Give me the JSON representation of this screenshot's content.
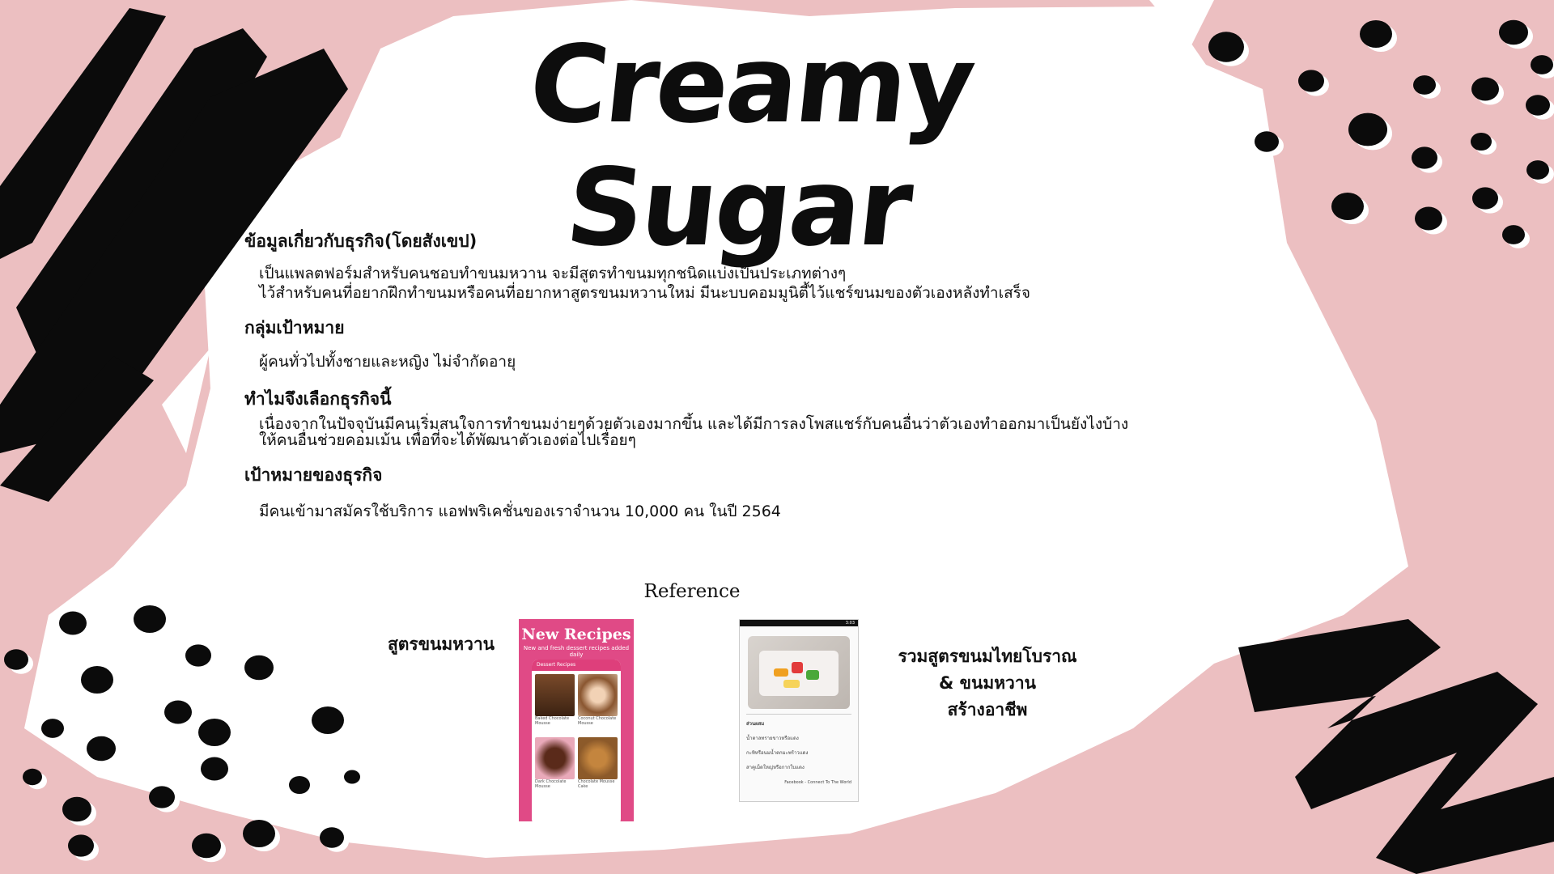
{
  "title": "Creamy Sugar",
  "sections": [
    {
      "heading": "ข้อมูลเกี่ยวกับธุรกิจ(โดยสังเขป)",
      "lines": [
        "เป็นแพลตฟอร์มสำหรับคนชอบทำขนมหวาน จะมีสูตรทำขนมทุกชนิดแบ่งเป็นประเภทต่างๆ",
        "ไว้สำหรับคนที่อยากฝึกทำขนมหรือคนที่อยากหาสูตรขนมหวานใหม่ มีนะบบคอมมูนิตี้ไว้แชร์ขนมของตัวเองหลังทำเสร็จ"
      ]
    },
    {
      "heading": "กลุ่มเป้าหมาย",
      "lines": [
        "ผู้คนทั่วไปทั้งชายและหญิง ไม่จำกัดอายุ"
      ]
    },
    {
      "heading": "ทำไมจึงเลือกธุรกิจนี้",
      "lines": [
        "เนื่องจากในปัจจุบันมีคนเริ่มสนใจการทำขนมง่ายๆด้วยตัวเองมากขึ้น และได้มีการลงโพสแชร์กับคนอื่นว่าตัวเองทำออกมาเป็นยังไงบ้าง",
        "ให้คนอื่นช่วยคอมเม้น เพื่อที่จะได้พัฒนาตัวเองต่อไปเรื่อยๆ"
      ]
    },
    {
      "heading": "เป้าหมายของธุรกิจ",
      "lines": [
        "มีคนเข้ามาสมัครใช้บริการ แอฟพริเคชั่นของเราจำนวน 10,000 คน ในปี 2564"
      ]
    }
  ],
  "reference": {
    "title": "Reference",
    "left_label": "สูตรขนมหวาน",
    "right_label_lines": [
      "รวมสูตรขนมไทยโบราณ",
      "& ขนมหวาน",
      "สร้างอาชีพ"
    ],
    "app1": {
      "headline": "New Recipes",
      "subline": "New and fresh dessert recipes added daily",
      "bar": "Dessert Recipes",
      "items": [
        "Baked Chocolate Mousse",
        "Coconut Chocolate Mousse",
        "Dark Chocolate Mousse",
        "Chocolate Mousse Cake"
      ]
    },
    "app2": {
      "status": "3:03",
      "lines": [
        "ส่วนผสม",
        "น้ำตาลทรายขาวหรือแดง",
        "กะทิหรือนมน้ำตกมะพร้าวแดง",
        "สาคูเม็ดใหญ่หรือกากใบแดง",
        "Facebook - Connect To The World"
      ]
    }
  },
  "colors": {
    "background": "#ecbfc1",
    "paper": "#ffffff",
    "ink": "#0d0d0d",
    "accent": "#e04a86"
  }
}
